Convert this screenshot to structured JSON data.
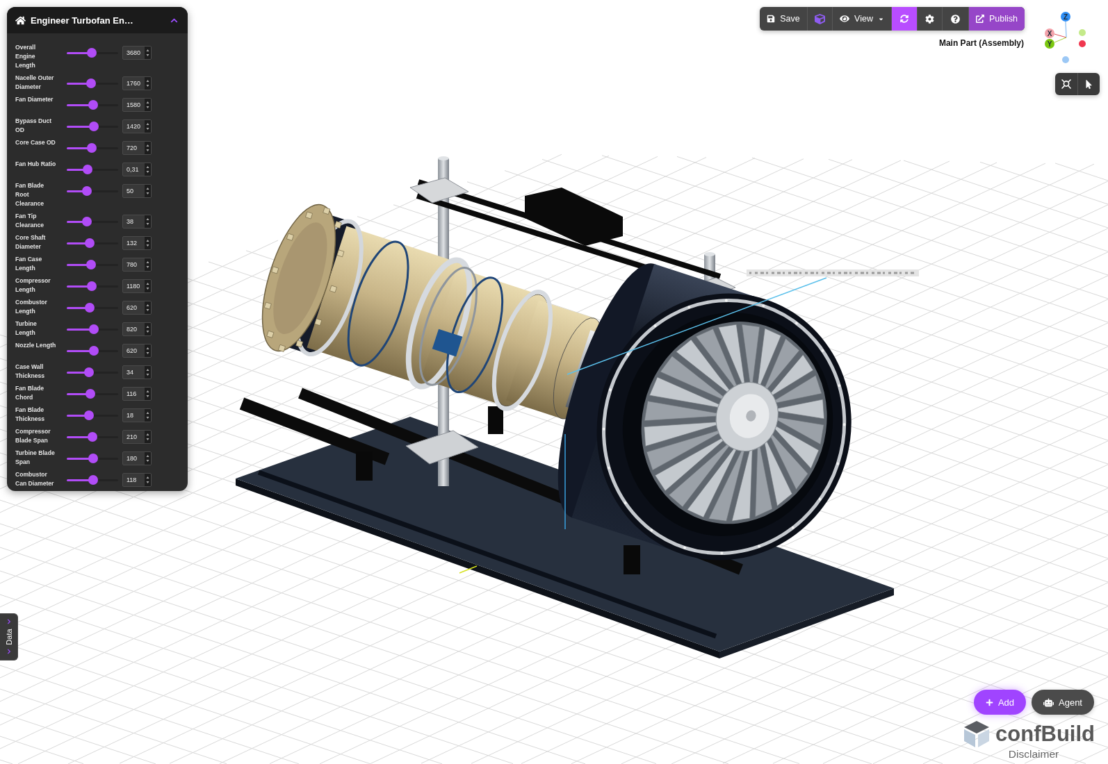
{
  "panel": {
    "title": "Engineer Turbofan En…",
    "expanded": true
  },
  "parameters": [
    {
      "label": "Overall Engine Length",
      "level": 0.49,
      "value": "3680"
    },
    {
      "label": "Nacelle Outer Diameter",
      "level": 0.46,
      "value": "1760"
    },
    {
      "label": "Fan Diameter",
      "level": 0.52,
      "value": "1580"
    },
    {
      "label": "Bypass Duct OD",
      "level": 0.53,
      "value": "1420"
    },
    {
      "label": "Core Case OD",
      "level": 0.48,
      "value": "720"
    },
    {
      "label": "Fan Hub Ratio",
      "level": 0.38,
      "value": "0,31"
    },
    {
      "label": "Fan Blade Root Clearance",
      "level": 0.37,
      "value": "50"
    },
    {
      "label": "Fan Tip Clearance",
      "level": 0.37,
      "value": "38"
    },
    {
      "label": "Core Shaft Diameter",
      "level": 0.44,
      "value": "132"
    },
    {
      "label": "Fan Case Length",
      "level": 0.46,
      "value": "780"
    },
    {
      "label": "Compressor Length",
      "level": 0.49,
      "value": "1180"
    },
    {
      "label": "Combustor Length",
      "level": 0.43,
      "value": "620"
    },
    {
      "label": "Turbine Length",
      "level": 0.53,
      "value": "820"
    },
    {
      "label": "Nozzle Length",
      "level": 0.53,
      "value": "620"
    },
    {
      "label": "Case Wall Thickness",
      "level": 0.42,
      "value": "34"
    },
    {
      "label": "Fan Blade Chord",
      "level": 0.45,
      "value": "116"
    },
    {
      "label": "Fan Blade Thickness",
      "level": 0.41,
      "value": "18"
    },
    {
      "label": "Compressor Blade Span",
      "level": 0.5,
      "value": "210"
    },
    {
      "label": "Turbine Blade Span",
      "level": 0.51,
      "value": "180"
    },
    {
      "label": "Combustor Can Diameter",
      "level": 0.51,
      "value": "118"
    }
  ],
  "toolbar": [
    {
      "kind": "save",
      "label": "Save",
      "on": false
    },
    {
      "kind": "model",
      "on": false
    },
    {
      "kind": "view",
      "label": "View",
      "on": false
    },
    {
      "kind": "regenerate",
      "on": true
    },
    {
      "kind": "settings",
      "on": false
    },
    {
      "kind": "help",
      "on": false
    },
    {
      "kind": "publish",
      "label": "Publish",
      "on": false
    }
  ],
  "selection_label": "Main Part (Assembly)",
  "axis_gizmo": {
    "axes": [
      {
        "label": "Z",
        "color": "#2f8ef4"
      },
      {
        "label": "X",
        "color": "#f3a2aa"
      },
      {
        "label": "Y",
        "color": "#7bc80f"
      }
    ]
  },
  "view_tools": [
    {
      "kind": "fit"
    },
    {
      "kind": "pointer"
    }
  ],
  "actions": [
    {
      "kind": "add",
      "label": "Add"
    },
    {
      "kind": "agent",
      "label": "Agent"
    }
  ],
  "brand": {
    "name": "confBuild",
    "link": "Disclaimer"
  },
  "side_tab": {
    "label": "Data"
  }
}
